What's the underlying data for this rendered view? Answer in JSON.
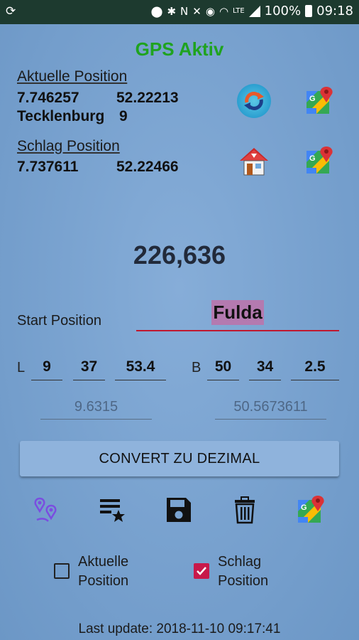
{
  "statusbar": {
    "left_icon": "sync-tablet-icon",
    "icons": [
      "location-icon",
      "bluetooth-icon",
      "nfc-icon",
      "mute-icon",
      "alarm-icon",
      "wifi-icon",
      "lte-icon",
      "signal-icon"
    ],
    "lte": "LTE",
    "battery": "100%",
    "time": "09:18"
  },
  "title": "GPS Aktiv",
  "current": {
    "label": "Aktuelle Position",
    "lon": "7.746257",
    "lat": "52.22213",
    "city": "Tecklenburg",
    "number": "9"
  },
  "target": {
    "label": "Schlag Position",
    "lon": "7.737611",
    "lat": "52.22466"
  },
  "distance": "226,636",
  "start": {
    "label": "Start Position",
    "value": "Fulda"
  },
  "coords": {
    "l_label": "L",
    "l_deg": "9",
    "l_min": "37",
    "l_sec": "53.4",
    "b_label": "B",
    "b_deg": "50",
    "b_min": "34",
    "b_sec": "2.5",
    "l_decimal": "9.6315",
    "b_decimal": "50.5673611"
  },
  "convert_button": "CONVERT ZU DEZIMAL",
  "toolbar": [
    "route-pins-icon",
    "favorites-list-icon",
    "save-icon",
    "delete-icon",
    "google-maps-icon"
  ],
  "checkboxes": {
    "current": {
      "line1": "Aktuelle",
      "line2": "Position",
      "checked": false
    },
    "target": {
      "line1": "Schlag",
      "line2": "Position",
      "checked": true
    }
  },
  "last_update": "Last update: 2018-11-10 09:17:41",
  "colors": {
    "title_green": "#1fa31f",
    "underline_red": "#c0182f",
    "checkbox_checked": "#c8184a",
    "selection": "#b47ab0"
  }
}
